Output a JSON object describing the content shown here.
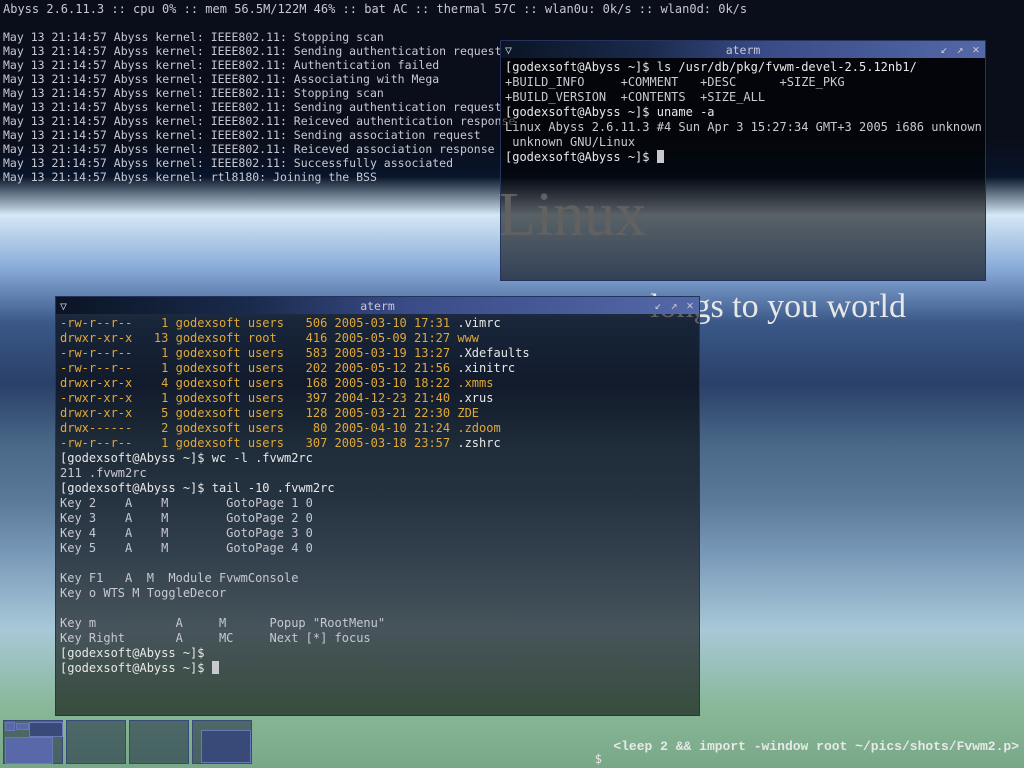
{
  "statusbar": "Abyss 2.6.11.3 :: cpu 0% :: mem 56.5M/122M 46% :: bat AC :: thermal 57C :: wlan0u: 0k/s :: wlan0d: 0k/s",
  "kernel_log": [
    "May 13 21:14:57 Abyss kernel: IEEE802.11: Stopping scan",
    "May 13 21:14:57 Abyss kernel: IEEE802.11: Sending authentication request",
    "May 13 21:14:57 Abyss kernel: IEEE802.11: Authentication failed",
    "May 13 21:14:57 Abyss kernel: IEEE802.11: Associating with Mega",
    "May 13 21:14:57 Abyss kernel: IEEE802.11: Stopping scan",
    "May 13 21:14:57 Abyss kernel: IEEE802.11: Sending authentication request",
    "May 13 21:14:57 Abyss kernel: IEEE802.11: Reiceved authentication response",
    "May 13 21:14:57 Abyss kernel: IEEE802.11: Sending association request",
    "May 13 21:14:57 Abyss kernel: IEEE802.11: Reiceved association response",
    "May 13 21:14:57 Abyss kernel: IEEE802.11: Successfully associated",
    "May 13 21:14:57 Abyss kernel: rtl8180: Joining the BSS"
  ],
  "wallpaper": {
    "linux": "Linux",
    "sub": "longs to you world"
  },
  "term_top": {
    "title": "aterm",
    "lines": [
      {
        "p": "[godexsoft@Abyss ~]$ ",
        "c": "ls /usr/db/pkg/fvwm-devel-2.5.12nb1/"
      },
      {
        "o": "+BUILD_INFO     +COMMENT   +DESC      +SIZE_PKG"
      },
      {
        "o": "+BUILD_VERSION  +CONTENTS  +SIZE_ALL"
      },
      {
        "p": "[godexsoft@Abyss ~]$ ",
        "c": "uname -a"
      },
      {
        "o": "Linux Abyss 2.6.11.3 #4 Sun Apr 3 15:27:34 GMT+3 2005 i686 unknown unknown GNU/Linux"
      },
      {
        "p": "[godexsoft@Abyss ~]$ ",
        "cur": true
      }
    ]
  },
  "term_main": {
    "title": "aterm",
    "ls_rows": [
      {
        "perm": "-rw-r--r--",
        "n": "1",
        "u": "godexsoft",
        "g": "users",
        "sz": "506",
        "dt": "2005-03-10 17:31",
        "f": ".vimrc",
        "dir": false
      },
      {
        "perm": "drwxr-xr-x",
        "n": "13",
        "u": "godexsoft",
        "g": "root ",
        "sz": "416",
        "dt": "2005-05-09 21:27",
        "f": "www",
        "dir": true
      },
      {
        "perm": "-rw-r--r--",
        "n": "1",
        "u": "godexsoft",
        "g": "users",
        "sz": "583",
        "dt": "2005-03-19 13:27",
        "f": ".Xdefaults",
        "dir": false
      },
      {
        "perm": "-rw-r--r--",
        "n": "1",
        "u": "godexsoft",
        "g": "users",
        "sz": "202",
        "dt": "2005-05-12 21:56",
        "f": ".xinitrc",
        "dir": false
      },
      {
        "perm": "drwxr-xr-x",
        "n": "4",
        "u": "godexsoft",
        "g": "users",
        "sz": "168",
        "dt": "2005-03-10 18:22",
        "f": ".xmms",
        "dir": true
      },
      {
        "perm": "-rwxr-xr-x",
        "n": "1",
        "u": "godexsoft",
        "g": "users",
        "sz": "397",
        "dt": "2004-12-23 21:40",
        "f": ".xrus",
        "dir": false
      },
      {
        "perm": "drwxr-xr-x",
        "n": "5",
        "u": "godexsoft",
        "g": "users",
        "sz": "128",
        "dt": "2005-03-21 22:30",
        "f": "ZDE",
        "dir": true
      },
      {
        "perm": "drwx------",
        "n": "2",
        "u": "godexsoft",
        "g": "users",
        "sz": "80",
        "dt": "2005-04-10 21:24",
        "f": ".zdoom",
        "dir": true
      },
      {
        "perm": "-rw-r--r--",
        "n": "1",
        "u": "godexsoft",
        "g": "users",
        "sz": "307",
        "dt": "2005-03-18 23:57",
        "f": ".zshrc",
        "dir": false
      }
    ],
    "after": [
      {
        "p": "[godexsoft@Abyss ~]$ ",
        "c": "wc -l .fvwm2rc"
      },
      {
        "o": "211 .fvwm2rc"
      },
      {
        "p": "[godexsoft@Abyss ~]$ ",
        "c": "tail -10 .fvwm2rc"
      },
      {
        "o": "Key 2    A    M        GotoPage 1 0"
      },
      {
        "o": "Key 3    A    M        GotoPage 2 0"
      },
      {
        "o": "Key 4    A    M        GotoPage 3 0"
      },
      {
        "o": "Key 5    A    M        GotoPage 4 0"
      },
      {
        "o": ""
      },
      {
        "o": "Key F1   A  M  Module FvwmConsole"
      },
      {
        "o": "Key o WTS M ToggleDecor"
      },
      {
        "o": ""
      },
      {
        "o": "Key m           A     M      Popup \"RootMenu\""
      },
      {
        "o": "Key Right       A     MC     Next [*] focus"
      },
      {
        "p": "[godexsoft@Abyss ~]$ ",
        "c": ""
      },
      {
        "p": "[godexsoft@Abyss ~]$ ",
        "cur": true
      }
    ]
  },
  "bottom_note": "<leep 2 && import -window root ~/pics/shots/Fvwm2.p>",
  "bottom_prompt": "$"
}
